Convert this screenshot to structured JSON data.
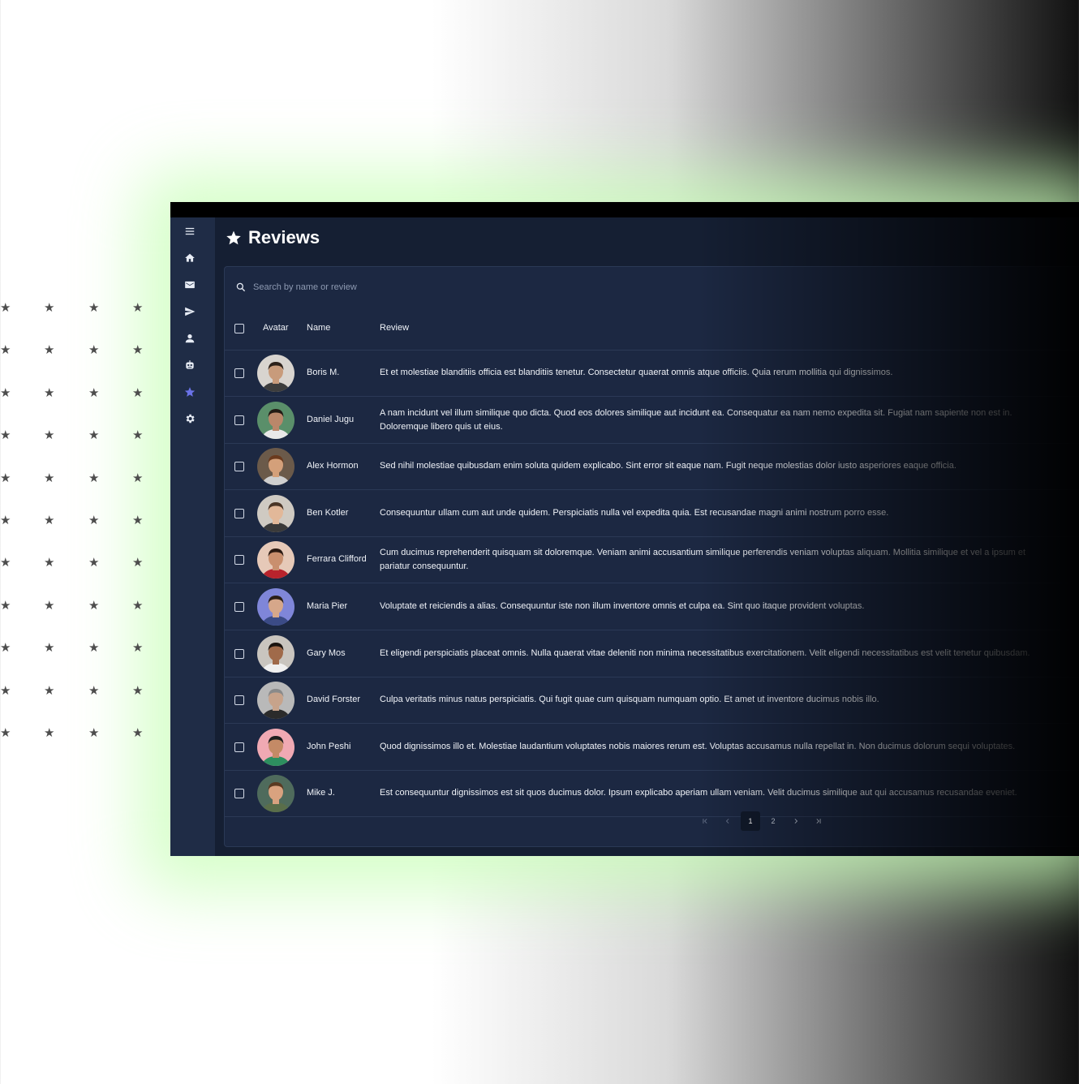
{
  "page": {
    "title": "Reviews",
    "title_icon": "star-icon"
  },
  "sidebar": {
    "items": [
      {
        "icon": "menu-icon"
      },
      {
        "icon": "home-icon"
      },
      {
        "icon": "mail-icon"
      },
      {
        "icon": "send-icon"
      },
      {
        "icon": "user-icon"
      },
      {
        "icon": "robot-icon"
      },
      {
        "icon": "star-icon",
        "active": true
      },
      {
        "icon": "gear-icon"
      }
    ],
    "active_color": "#6a72e8"
  },
  "search": {
    "placeholder": "Search by name or review",
    "value": ""
  },
  "table": {
    "headers": {
      "avatar": "Avatar",
      "name": "Name",
      "review": "Review"
    },
    "rows": [
      {
        "name": "Boris M.",
        "review": "Et et molestiae blanditiis officia est blanditiis tenetur. Consectetur quaerat omnis atque officiis. Quia rerum mollitia qui dignissimos."
      },
      {
        "name": "Daniel Jugu",
        "review": "A nam incidunt vel illum similique quo dicta. Quod eos dolores similique aut incidunt ea. Consequatur ea nam nemo expedita sit. Fugiat nam sapiente non est in. Doloremque libero quis ut eius."
      },
      {
        "name": "Alex Hormon",
        "review": "Sed nihil molestiae quibusdam enim soluta quidem explicabo. Sint error sit eaque nam. Fugit neque molestias dolor iusto asperiores eaque officia."
      },
      {
        "name": "Ben Kotler",
        "review": "Consequuntur ullam cum aut unde quidem. Perspiciatis nulla vel expedita quia. Est recusandae magni animi nostrum porro esse."
      },
      {
        "name": "Ferrara Clifford",
        "review": "Cum ducimus reprehenderit quisquam sit doloremque. Veniam animi accusantium similique perferendis veniam voluptas aliquam. Mollitia similique et vel a ipsum et pariatur consequuntur."
      },
      {
        "name": "Maria Pier",
        "review": "Voluptate et reiciendis a alias. Consequuntur iste non illum inventore omnis et culpa ea. Sint quo itaque provident voluptas."
      },
      {
        "name": "Gary Mos",
        "review": "Et eligendi perspiciatis placeat omnis. Nulla quaerat vitae deleniti non minima necessitatibus exercitationem. Velit eligendi necessitatibus est velit tenetur quibusdam."
      },
      {
        "name": "David Forster",
        "review": "Culpa veritatis minus natus perspiciatis. Qui fugit quae cum quisquam numquam optio. Et amet ut inventore ducimus nobis illo."
      },
      {
        "name": "John Peshi",
        "review": "Quod dignissimos illo et. Molestiae laudantium voluptates nobis maiores rerum est. Voluptas accusamus nulla repellat in. Non ducimus dolorum sequi voluptates."
      },
      {
        "name": "Mike J.",
        "review": "Est consequuntur dignissimos est sit quos ducimus dolor. Ipsum explicabo aperiam ullam veniam. Velit ducimus similique aut qui accusamus recusandae eveniet."
      }
    ]
  },
  "pagination": {
    "pages": [
      "1",
      "2"
    ],
    "current": "1",
    "icons": [
      "first-page-icon",
      "previous-page-icon",
      "next-page-icon",
      "last-page-icon"
    ]
  }
}
